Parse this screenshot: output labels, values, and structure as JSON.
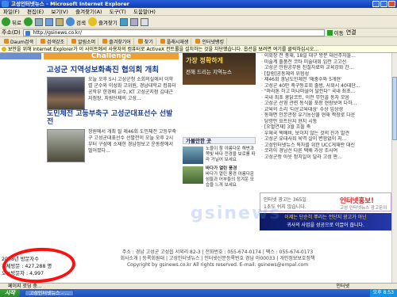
{
  "window": {
    "title": "고성인터넷뉴스 - Microsoft Internet Explorer"
  },
  "menu": [
    "파일(F)",
    "편집(E)",
    "보기(V)",
    "즐겨찾기(A)",
    "도구(T)",
    "도움말(H)"
  ],
  "toolbar": {
    "back": "뒤로",
    "search": "검색",
    "favorites": "즐겨찾기"
  },
  "address": {
    "label": "주소(D)",
    "url": "http://gsinews.co.kr/",
    "go": "이동",
    "links": "연결"
  },
  "linksbar": [
    "Daum검색",
    "검색강조",
    "알림소머",
    "즐겨찾기어",
    "찾기",
    "플래시재생",
    "인터넷뱅킹"
  ],
  "infobar": "보안을 위해 Internet Explorer가 이 사이트에서 사용자의 컴퓨터로 ActiveX 컨트롤을 설치하는 것을 차단했습니다. 옵션을 보려면 여기를 클릭하십시오...",
  "main": {
    "challenge": "Challenge",
    "headline1": "고성군 지역성보화촉진 협의회 개최",
    "story1": "오늘 오후 5시 고성군청 소회의실에서 이학렬 군수와 이성화 고위원, 경남대학교 컴퓨터 공학부 한경배 교수, KT 고성군지점 김대근 지점장, 지원단체의 고성...",
    "headline2": "도민체전 고등부축구 고성군대표선수 선발전",
    "story2": "창원에서 개최 될 제46회 도민체전 고등부축구 고성군대표선수 선발전이 오늘 오후 2시부터 구성에 소재한 경남정보고 운동장에서 벌어졌다..."
  },
  "middle": {
    "banner_top": "가장 정확하게",
    "banner_bottom": "전해 드리는 지역뉴스",
    "box_title": "가볼만한 곳",
    "item1": "노을이 참 아름다운 해변과 쪽빛 바다 전경을 보로를 따라 거닐어 보세요",
    "item2_title": "바다가 열린 풍경",
    "item2": "바다가 열린 풍경 아름다운 섬들과 어부들의 정겨운 모습을 느껴 보세요"
  },
  "right": {
    "news": [
      "이회창 전 총재, 18일 대구 방문 대선주자들...",
      "미술계 출품전 코타 미술대회 입전 고고선",
      "고성군 민원공무원 친절자료와 교육강화 간...",
      "[칼럼]공동체의 위험성",
      "제46회 경남도민체전 '재충수와 5개현'",
      "고성군 40만 축구동호회 출범, 사회시 40대단...",
      "\"마라톤 하고 마나마을어 달린다\" 국내 최초...",
      "국내 최초 쿵닭코트, 이전 무인골 동차 모음",
      "고성군 선영 관련 동식물 포장 현장보여 다하...",
      "교육의 소리 '다운교육대상' 수상 입상생",
      "동해면 인본관장 유기농산물 현재 짝장로 다운",
      "당항만 요트단지 현지 시동",
      "[오벌연재] 3월 흐들 축",
      "우체국 택배비, 보이지 않는 것의 진가 발견",
      "고성군 유대사회 육역 살이 변함없이 지...",
      "고성인터넷뉴스 독자를 위한 UCC게재란 대신",
      "코리아 경남선 다른 택배 가상 조사여",
      "고성군청 아웃 정치일이 달라 고성 판..."
    ],
    "promo1_a": "인터넷 광고는 365일",
    "promo1_b": "1초도 쉬지 않습니다.",
    "promo1_brand": "인터넷홍보!",
    "promo1_sub": "고성 인터넷뉴스 광고문의",
    "promo2_a": "이제는 단순히 뿌리는 전단지 광고가 아닌",
    "promo2_b": "귀사의 사업을 성공으로 이끌어 줍니다."
  },
  "footer": {
    "line1": "주소 : 경남 고성군 고성읍 서외리 82-3 | 전화번호 : 055-674-0174 | 팩스 : 055-674-0173",
    "line2": "회사소개 | 등록회원대 | 고성인터넷뉴스 | 인터넷신문등록번호 경남 아00033 | 개인정보보호정책",
    "line3": "Copyright by gsinews.co.kr All rights reserved. E-mail: gsinews@empal.com"
  },
  "visitors": {
    "today_label": "2008년 방문자수",
    "total_label": "전체방문",
    "total": "427,288 명",
    "today_label2": "오늘방문자",
    "today": "4,997"
  },
  "status": {
    "text": "페이지 로딩 중...",
    "zone": "인터넷"
  },
  "taskbar": {
    "start": "시작",
    "task": "고성인터넷뉴스 - ...",
    "clock": "오후 8:53"
  },
  "watermark": "gsinews"
}
